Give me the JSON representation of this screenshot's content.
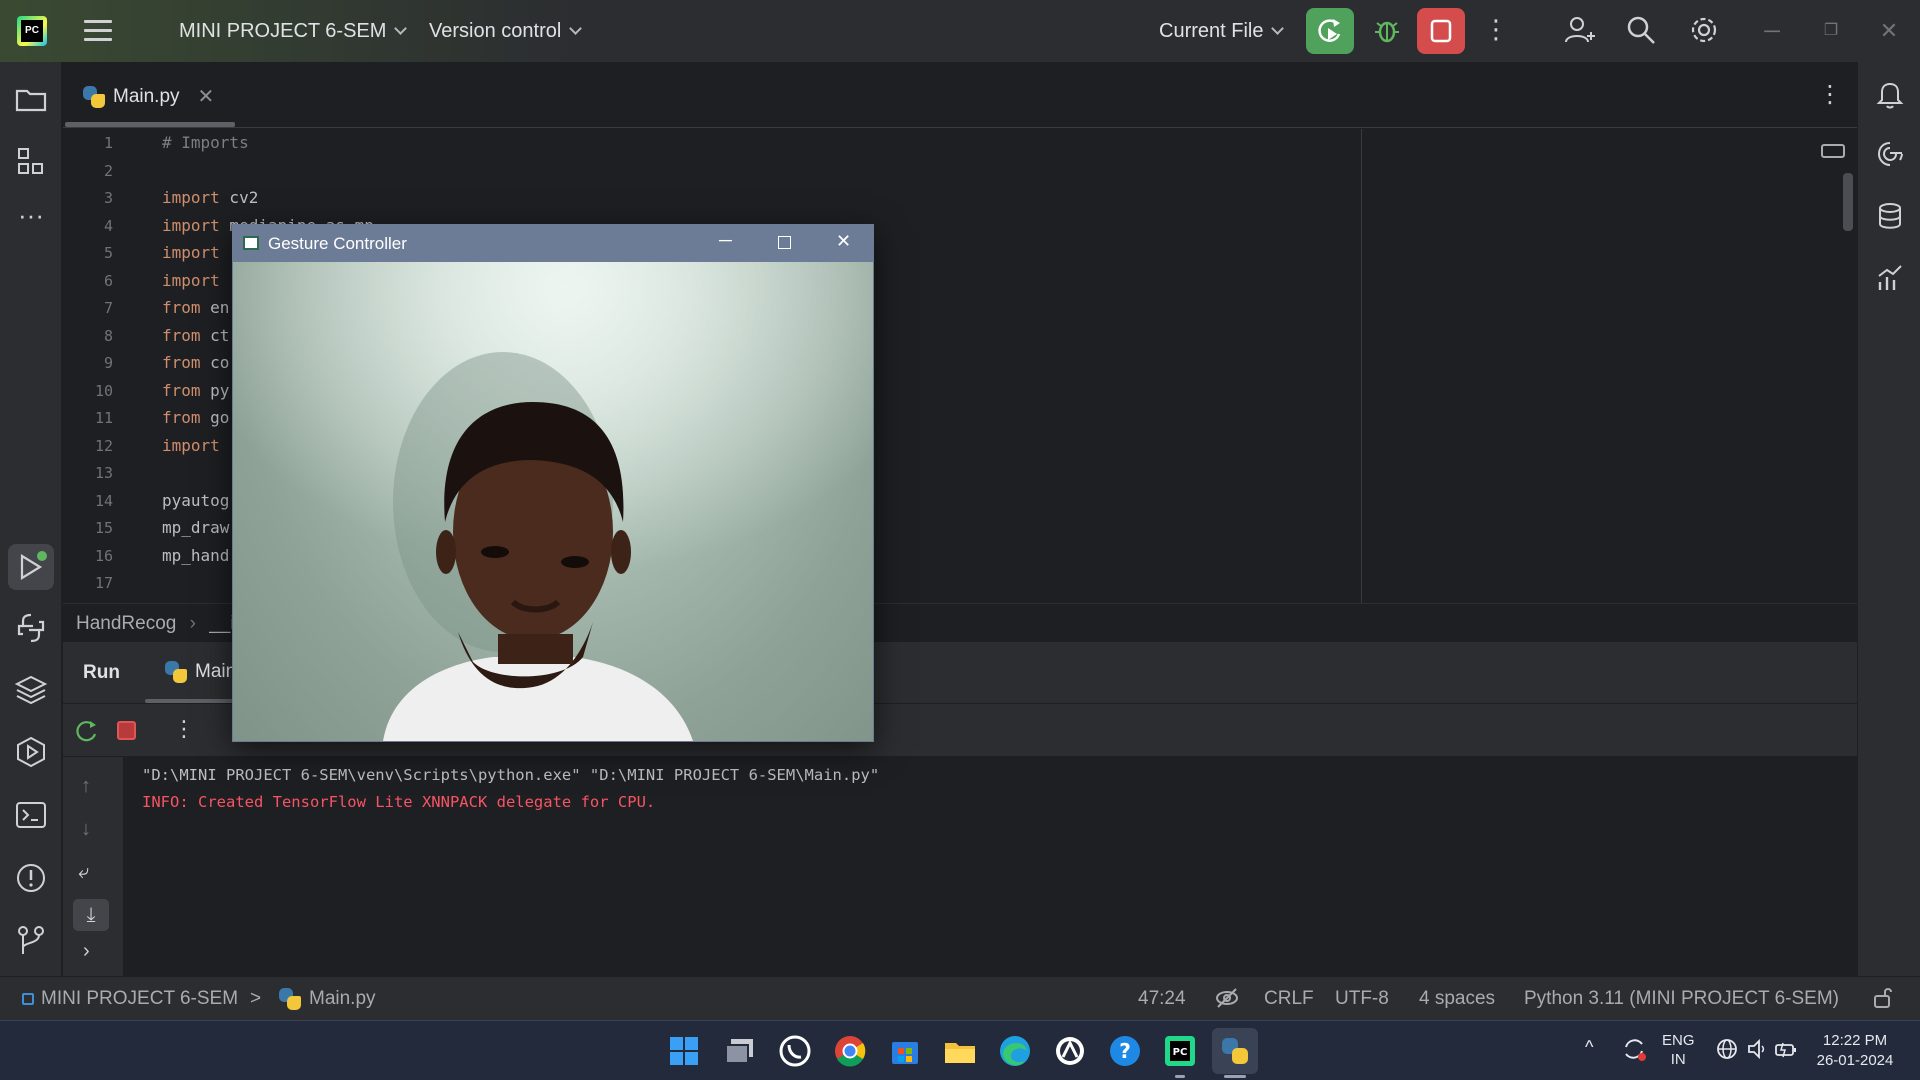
{
  "titlebar": {
    "project": "MINI PROJECT 6-SEM",
    "vcs": "Version control",
    "run_config": "Current File"
  },
  "editor": {
    "tab": "Main.py",
    "lines": [
      {
        "n": "1",
        "code": "# Imports",
        "type": "comment"
      },
      {
        "n": "2",
        "code": "",
        "type": "plain"
      },
      {
        "n": "3",
        "kw": "import",
        "code": " cv2"
      },
      {
        "n": "4",
        "kw": "import",
        "code": " mediapipe as mp"
      },
      {
        "n": "5",
        "kw": "import",
        "code": ""
      },
      {
        "n": "6",
        "kw": "import",
        "code": ""
      },
      {
        "n": "7",
        "kw": "from",
        "code": " en"
      },
      {
        "n": "8",
        "kw": "from",
        "code": " ct"
      },
      {
        "n": "9",
        "kw": "from",
        "code": " co"
      },
      {
        "n": "10",
        "kw": "from",
        "code": " py"
      },
      {
        "n": "11",
        "kw": "from",
        "code": " go"
      },
      {
        "n": "12",
        "kw": "import",
        "code": ""
      },
      {
        "n": "13",
        "code": ""
      },
      {
        "n": "14",
        "code": "pyautog"
      },
      {
        "n": "15",
        "code": "mp_draw"
      },
      {
        "n": "16",
        "code": "mp_hand"
      },
      {
        "n": "17",
        "code": ""
      }
    ]
  },
  "breadcrumbs": {
    "first": "HandRecog",
    "sep": "›",
    "second": "__i"
  },
  "run_panel": {
    "run_label": "Run",
    "tab_label": "Main"
  },
  "console": {
    "line1": "\"D:\\MINI PROJECT 6-SEM\\venv\\Scripts\\python.exe\" \"D:\\MINI PROJECT 6-SEM\\Main.py\"",
    "line2": "INFO: Created TensorFlow Lite XNNPACK delegate for CPU."
  },
  "statusbar": {
    "project": "MINI PROJECT 6-SEM",
    "sep": ">",
    "file": "Main.py",
    "position": "47:24",
    "line_ending": "CRLF",
    "encoding": "UTF-8",
    "indent": "4 spaces",
    "interpreter": "Python 3.11 (MINI PROJECT 6-SEM)"
  },
  "floating_window": {
    "title": "Gesture Controller"
  },
  "taskbar": {
    "lang_line1": "ENG",
    "lang_line2": "IN",
    "time": "12:22 PM",
    "date": "26-01-2024"
  },
  "colors": {
    "run_green": "#4fa15c",
    "stop_red": "#d54c4c",
    "error_red": "#f75464",
    "keyword": "#cf8e6d"
  }
}
